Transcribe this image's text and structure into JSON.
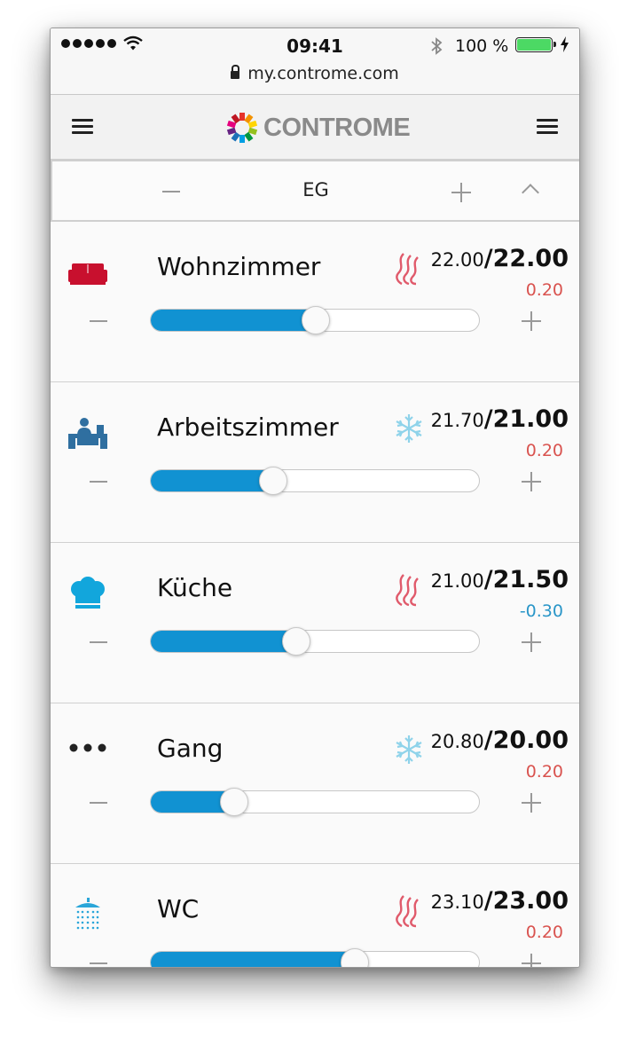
{
  "statusbar": {
    "time": "09:41",
    "battery_text": "100 %",
    "battery_level": 1.0,
    "url": "my.controme.com"
  },
  "navbar": {
    "logo_text": "CONTROME"
  },
  "floor": {
    "label": "EG"
  },
  "colors": {
    "heat": "#e05a6b",
    "cool": "#8fd3ea",
    "slider": "#1192d2",
    "offset_positive": "#d9534f",
    "offset_negative": "#2a96c8"
  },
  "rooms": [
    {
      "name": "Wohnzimmer",
      "icon": "sofa-icon",
      "mode": "heating-icon",
      "actual": "22.00",
      "target": "22.00",
      "offset": "0.20",
      "offset_sign": "positive",
      "level": 0.5
    },
    {
      "name": "Arbeitszimmer",
      "icon": "office-desk-icon",
      "mode": "cooling-icon",
      "actual": "21.70",
      "target": "21.00",
      "offset": "0.20",
      "offset_sign": "positive",
      "level": 0.37
    },
    {
      "name": "Küche",
      "icon": "chef-hat-icon",
      "mode": "heating-icon",
      "actual": "21.00",
      "target": "21.50",
      "offset": "-0.30",
      "offset_sign": "negative",
      "level": 0.44
    },
    {
      "name": "Gang",
      "icon": "more-dots-icon",
      "mode": "cooling-icon",
      "actual": "20.80",
      "target": "20.00",
      "offset": "0.20",
      "offset_sign": "positive",
      "level": 0.25
    },
    {
      "name": "WC",
      "icon": "shower-icon",
      "mode": "heating-icon",
      "actual": "23.10",
      "target": "23.00",
      "offset": "0.20",
      "offset_sign": "positive",
      "level": 0.62
    }
  ]
}
